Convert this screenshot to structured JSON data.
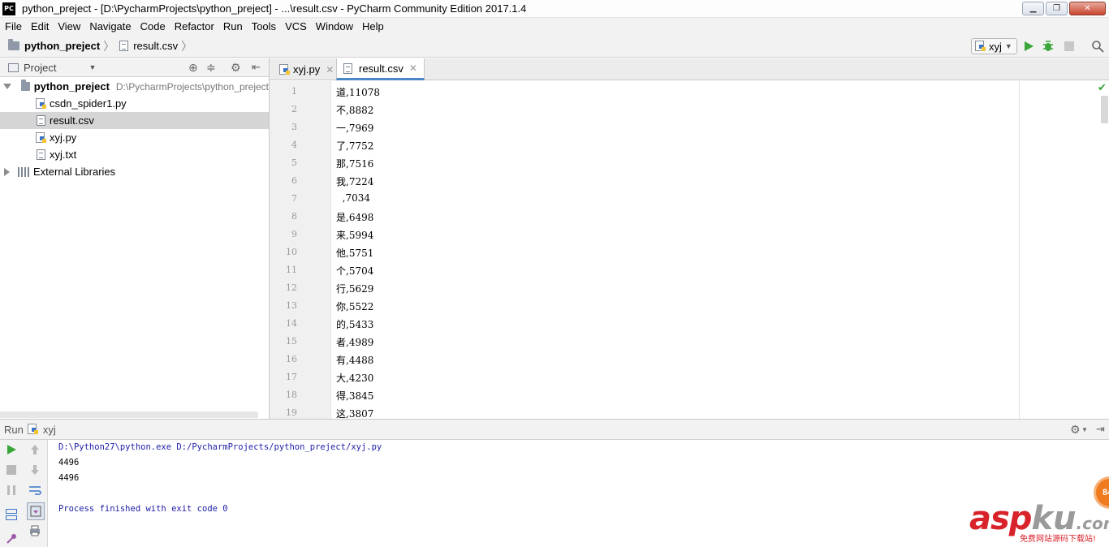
{
  "window": {
    "app_logo": "PC",
    "title": "python_preject - [D:\\PycharmProjects\\python_preject] - ...\\result.csv - PyCharm Community Edition 2017.1.4",
    "controls": {
      "minimize": "▁",
      "maximize": "❐",
      "close": "✕"
    }
  },
  "menu": [
    "File",
    "Edit",
    "View",
    "Navigate",
    "Code",
    "Refactor",
    "Run",
    "Tools",
    "VCS",
    "Window",
    "Help"
  ],
  "navbar": {
    "project": "python_preject",
    "file": "result.csv",
    "run_config": "xyj"
  },
  "project_panel": {
    "title": "Project",
    "root_name": "python_preject",
    "root_path": "D:\\PycharmProjects\\python_preject",
    "files": [
      "csdn_spider1.py",
      "result.csv",
      "xyj.py",
      "xyj.txt"
    ],
    "external": "External Libraries"
  },
  "editor": {
    "tabs": [
      "xyj.py",
      "result.csv"
    ],
    "active_tab": "result.csv",
    "line_numbers": [
      "1",
      "2",
      "3",
      "4",
      "5",
      "6",
      "7",
      "8",
      "9",
      "10",
      "11",
      "12",
      "13",
      "14",
      "15",
      "16",
      "17",
      "18",
      "19"
    ],
    "lines": [
      "道,11078",
      "不,8882",
      "一,7969",
      "了,7752",
      "那,7516",
      "我,7224",
      "  ,7034",
      "是,6498",
      "来,5994",
      "他,5751",
      "个,5704",
      "行,5629",
      "你,5522",
      "的,5433",
      "者,4989",
      "有,4488",
      "大,4230",
      "得,3845",
      "这,3807"
    ]
  },
  "run_panel": {
    "label": "Run",
    "config": "xyj",
    "console": [
      "D:\\Python27\\python.exe D:/PycharmProjects/python_preject/xyj.py",
      "4496",
      "4496",
      "",
      "Process finished with exit code 0"
    ]
  },
  "watermark": {
    "asp": "asp",
    "ku": "ku",
    "com": ".com",
    "sub": "免费网站源码下载站!",
    "badge": "84"
  },
  "colors": {
    "run_green": "#3aa63a",
    "tab_accent": "#4a88c7",
    "console_blue": "#1d1da8",
    "watermark_red": "#d8232a"
  }
}
